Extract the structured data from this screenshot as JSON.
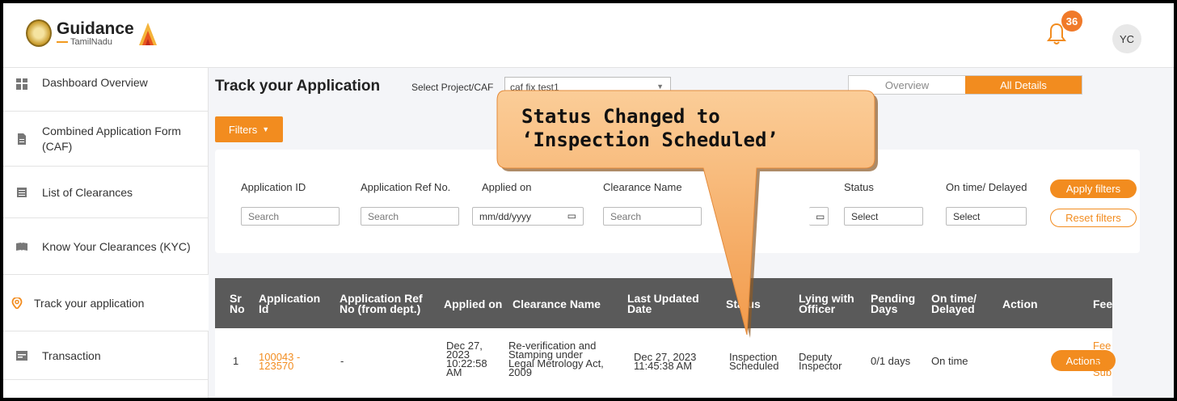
{
  "header": {
    "logo_title": "Guidance",
    "logo_subtitle": "TamilNadu",
    "notification_count": "36",
    "avatar_initials": "YC"
  },
  "sidebar": {
    "items": [
      {
        "label": "Dashboard Overview",
        "icon": "grid-icon"
      },
      {
        "label": "Combined Application Form (CAF)",
        "icon": "document-icon"
      },
      {
        "label": "List of Clearances",
        "icon": "list-icon"
      },
      {
        "label": "Know Your Clearances (KYC)",
        "icon": "book-icon"
      },
      {
        "label": "Track your application",
        "icon": "location-pin-icon"
      },
      {
        "label": "Transaction",
        "icon": "card-icon"
      }
    ]
  },
  "main": {
    "title": "Track your Application",
    "select_label": "Select Project/CAF",
    "select_value": "caf fix test1",
    "view_toggle": {
      "overview": "Overview",
      "all_details": "All Details"
    },
    "filters_button": "Filters",
    "filters": {
      "application_id": {
        "label": "Application ID",
        "placeholder": "Search"
      },
      "application_ref": {
        "label": "Application Ref No.",
        "placeholder": "Search"
      },
      "applied_on": {
        "label": "Applied on",
        "placeholder": "mm/dd/yyyy"
      },
      "clearance_name": {
        "label": "Clearance Name",
        "placeholder": "Search"
      },
      "status": {
        "label": "Status",
        "placeholder": "Select"
      },
      "on_time": {
        "label": "On time/ Delayed",
        "placeholder": "Select"
      },
      "apply_label": "Apply filters",
      "reset_label": "Reset filters"
    }
  },
  "table": {
    "headers": {
      "sr": "Sr No",
      "app_id": "Application Id",
      "ref_no": "Application Ref No (from dept.)",
      "applied_on": "Applied on",
      "clearance": "Clearance Name",
      "last_updated": "Last Updated Date",
      "status": "Status",
      "lying_with": "Lying with Officer",
      "pending": "Pending Days",
      "on_time": "On time/ Delayed",
      "action": "Action",
      "fee": "Fee"
    },
    "row": {
      "sr": "1",
      "app_id": "100043 - 123570",
      "ref_no": "-",
      "applied_on": "Dec 27, 2023 10:22:58 AM",
      "clearance": "Re-verification and Stamping under Legal Metrology Act, 2009",
      "last_updated": "Dec 27, 2023 11:45:38 AM",
      "status": "Inspection Scheduled",
      "lying_with": "Deputy Inspector",
      "pending": "0/1 days",
      "on_time": "On time",
      "action": "Actions",
      "fee": "Fee on App Sub"
    }
  },
  "callout": {
    "line1": "Status Changed to",
    "line2": "‘Inspection Scheduled’"
  },
  "colors": {
    "accent": "#f28c1f",
    "header_row": "#5a5a5a",
    "callout": "#f7a85c"
  }
}
